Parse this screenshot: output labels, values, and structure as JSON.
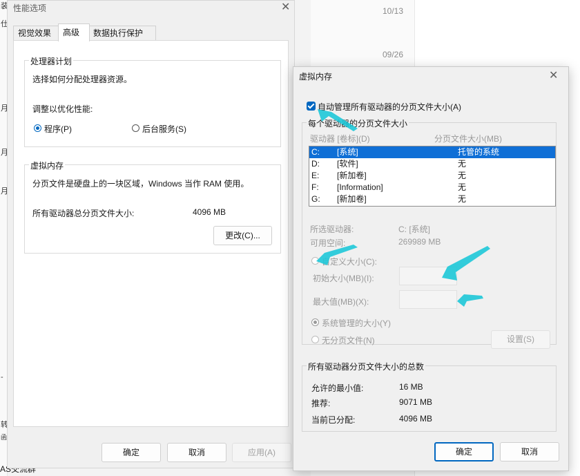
{
  "background": {
    "dates": [
      "10/13",
      "09/26"
    ],
    "left_fragments": [
      "装",
      "仕",
      "月",
      "月",
      "月",
      "-",
      "转",
      "函",
      "AS交流群"
    ]
  },
  "perf_dialog": {
    "title": "性能选项",
    "tabs": [
      {
        "label": "视觉效果",
        "active": false
      },
      {
        "label": "高级",
        "active": true
      },
      {
        "label": "数据执行保护",
        "active": false
      }
    ],
    "processor_group": {
      "legend": "处理器计划",
      "desc": "选择如何分配处理器资源。",
      "adjust_label": "调整以优化性能:",
      "options": [
        {
          "label": "程序(P)",
          "checked": true
        },
        {
          "label": "后台服务(S)",
          "checked": false
        }
      ]
    },
    "vm_group": {
      "legend": "虚拟内存",
      "desc": "分页文件是硬盘上的一块区域，Windows 当作 RAM 使用。",
      "total_label": "所有驱动器总分页文件大小:",
      "total_value": "4096 MB",
      "change_button": "更改(C)..."
    },
    "buttons": {
      "ok": "确定",
      "cancel": "取消",
      "apply": "应用(A)"
    }
  },
  "vm_dialog": {
    "title": "虚拟内存",
    "auto_manage_label": "自动管理所有驱动器的分页文件大小(A)",
    "auto_manage_checked": true,
    "per_drive_legend": "每个驱动器的分页文件大小",
    "col_drive": "驱动器 [卷标](D)",
    "col_size": "分页文件大小(MB)",
    "drives": [
      {
        "drive": "C:",
        "label": "[系统]",
        "size": "托管的系统",
        "selected": true
      },
      {
        "drive": "D:",
        "label": "[软件]",
        "size": "无",
        "selected": false
      },
      {
        "drive": "E:",
        "label": "[新加卷]",
        "size": "无",
        "selected": false
      },
      {
        "drive": "F:",
        "label": "[Information]",
        "size": "无",
        "selected": false
      },
      {
        "drive": "G:",
        "label": "[新加卷]",
        "size": "无",
        "selected": false
      }
    ],
    "selected_drive_label": "所选驱动器:",
    "selected_drive_value": "C:  [系统]",
    "free_space_label": "可用空间:",
    "free_space_value": "269989 MB",
    "custom_size_label": "自定义大小(C):",
    "initial_size_label": "初始大小(MB)(I):",
    "max_size_label": "最大值(MB)(X):",
    "system_managed_label": "系统管理的大小(Y)",
    "no_paging_label": "无分页文件(N)",
    "set_button": "设置(S)",
    "totals_legend": "所有驱动器分页文件大小的总数",
    "min_allowed_label": "允许的最小值:",
    "min_allowed_value": "16 MB",
    "recommended_label": "推荐:",
    "recommended_value": "9071 MB",
    "current_label": "当前已分配:",
    "current_value": "4096 MB",
    "buttons": {
      "ok": "确定",
      "cancel": "取消"
    }
  },
  "colors": {
    "accent": "#0067c0",
    "selection": "#0f6fd6",
    "annotation_arrow": "#1ec8d8"
  }
}
